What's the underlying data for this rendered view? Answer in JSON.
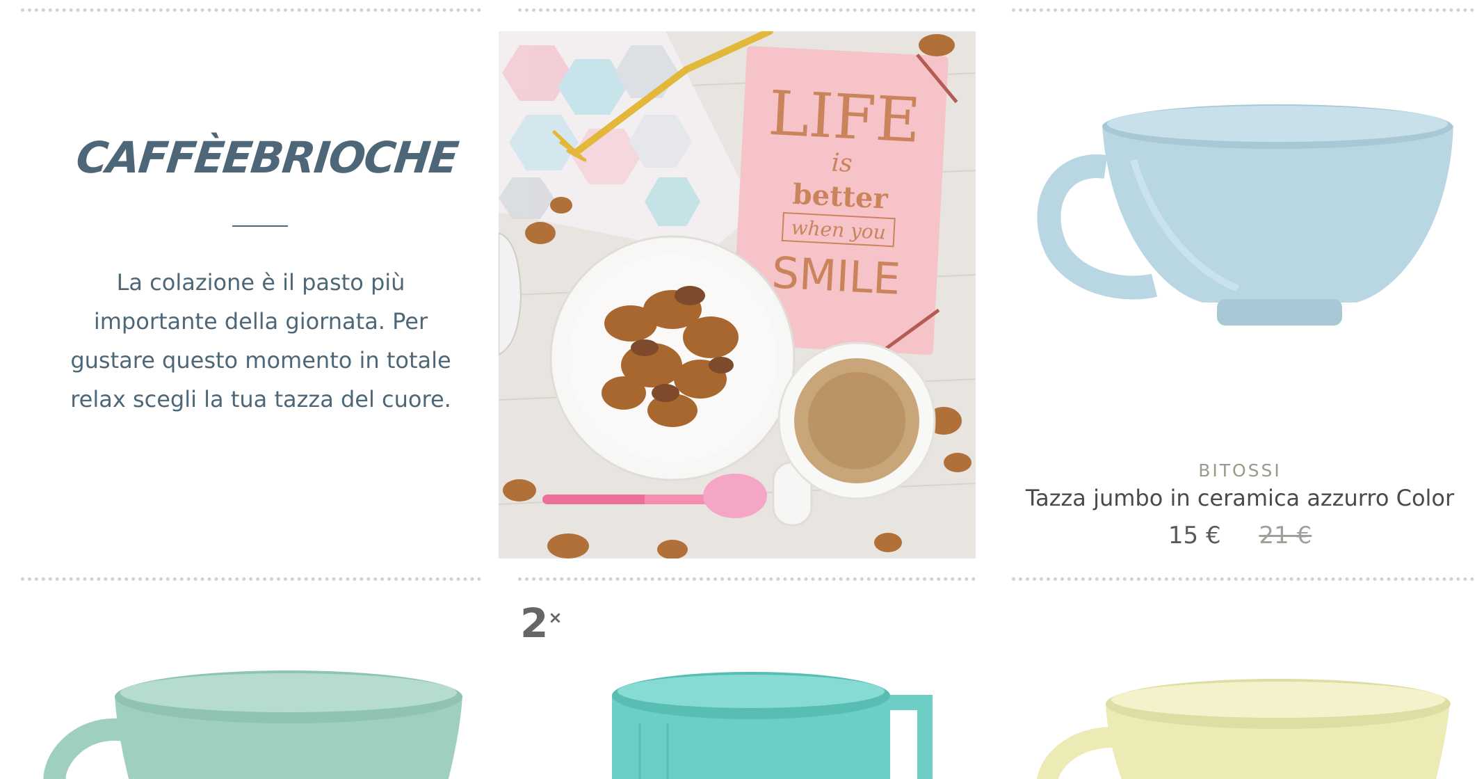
{
  "intro": {
    "brand": "CAFFÈEBRIOCHE",
    "text": "La colazione è il pasto più importante della giornata. Per gustare questo momento in totale relax scegli la tua tazza del cuore."
  },
  "photo": {
    "card_line1": "LIFE",
    "card_line2": "is",
    "card_line3": "better",
    "card_line4": "when you",
    "card_line5": "SMILE"
  },
  "featured_product": {
    "brand": "BITOSSI",
    "name": "Tazza jumbo in ceramica azzurro Color",
    "price": "15 €",
    "old_price": "21 €",
    "color": "#b9d6e3"
  },
  "row2": {
    "badge_number": "2",
    "badge_suffix": "×",
    "cups": [
      {
        "color": "#9fd0bd"
      },
      {
        "color": "#6ccec4"
      },
      {
        "color": "#ecebb6"
      }
    ]
  }
}
